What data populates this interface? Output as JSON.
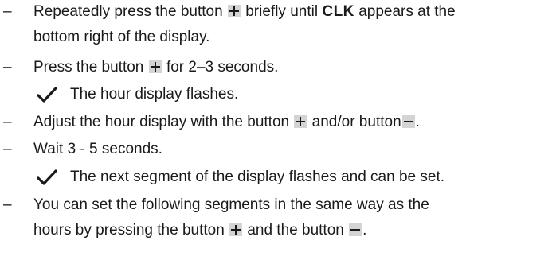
{
  "bullet_symbol": "–",
  "icons": {
    "plus_button": "plus-button-icon",
    "minus_button": "minus-button-icon",
    "result_check": "checkmark-icon"
  },
  "colors": {
    "text": "#1a1a1a",
    "button_background": "#d4d4d4"
  },
  "steps": [
    {
      "line1_pre": "Repeatedly press the button",
      "line1_mid": "briefly until",
      "line1_bold": "CLK",
      "line1_post": "appears at the",
      "line2": "bottom right of the display."
    },
    {
      "pre": "Press the button",
      "post": "for 2–3 seconds.",
      "result": "The hour display flashes."
    },
    {
      "pre": "Adjust the hour display with the button",
      "mid": "and/or button",
      "post": "."
    },
    {
      "text": "Wait 3 - 5 seconds.",
      "result": "The next segment of the display flashes and can be set."
    },
    {
      "line1": "You can set the following segments in the same way as the",
      "line2_pre": "hours by pressing the button",
      "line2_mid": "and the button",
      "line2_post": "."
    }
  ]
}
